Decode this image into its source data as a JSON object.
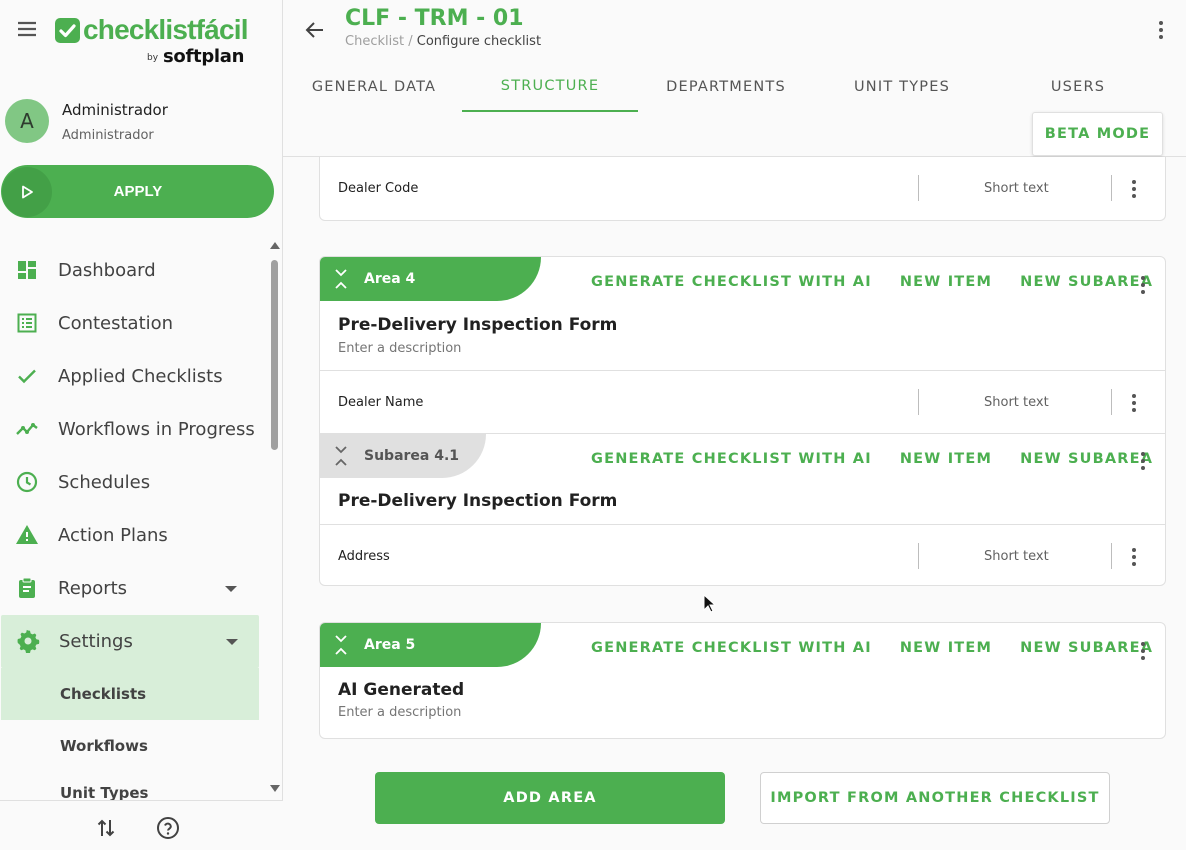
{
  "sidebar": {
    "logo_text": "checklistfácil",
    "logo_by": "by",
    "logo_sub": "softplan",
    "user": {
      "initial": "A",
      "name": "Administrador",
      "role": "Administrador"
    },
    "apply_label": "APPLY",
    "nav": [
      {
        "label": "Dashboard",
        "icon": "dashboard-icon"
      },
      {
        "label": "Contestation",
        "icon": "list-icon"
      },
      {
        "label": "Applied Checklists",
        "icon": "check-icon"
      },
      {
        "label": "Workflows in Progress",
        "icon": "trend-icon"
      },
      {
        "label": "Schedules",
        "icon": "clock-icon"
      },
      {
        "label": "Action Plans",
        "icon": "warning-icon"
      },
      {
        "label": "Reports",
        "icon": "clipboard-icon"
      },
      {
        "label": "Settings",
        "icon": "gear-icon"
      }
    ],
    "settings_sub": [
      "Checklists",
      "Workflows",
      "Unit Types"
    ]
  },
  "header": {
    "title": "CLF - TRM - 01",
    "breadcrumb_parent": "Checklist",
    "breadcrumb_sep": " / ",
    "breadcrumb_current": "Configure checklist",
    "tabs": [
      "GENERAL DATA",
      "STRUCTURE",
      "DEPARTMENTS",
      "UNIT TYPES",
      "USERS"
    ],
    "active_tab": "STRUCTURE",
    "beta_label": "BETA MODE"
  },
  "actions": {
    "generate": "GENERATE CHECKLIST WITH AI",
    "new_item": "NEW ITEM",
    "new_subarea": "NEW SUBAREA"
  },
  "items": {
    "dealer_code": {
      "name": "Dealer Code",
      "type": "Short text"
    },
    "dealer_name": {
      "name": "Dealer Name",
      "type": "Short text"
    },
    "address": {
      "name": "Address",
      "type": "Short text"
    }
  },
  "area4": {
    "label": "Area 4",
    "title": "Pre-Delivery Inspection Form",
    "description": "Enter a description",
    "subarea": {
      "label": "Subarea 4.1",
      "title": "Pre-Delivery Inspection Form"
    }
  },
  "area5": {
    "label": "Area 5",
    "title": "AI Generated",
    "description": "Enter a description"
  },
  "footer": {
    "add_area": "ADD AREA",
    "import": "IMPORT FROM ANOTHER CHECKLIST"
  },
  "colors": {
    "accent": "#4caf50",
    "accent_light": "#d8eed9",
    "subarea_tab": "#e0e0e0"
  }
}
